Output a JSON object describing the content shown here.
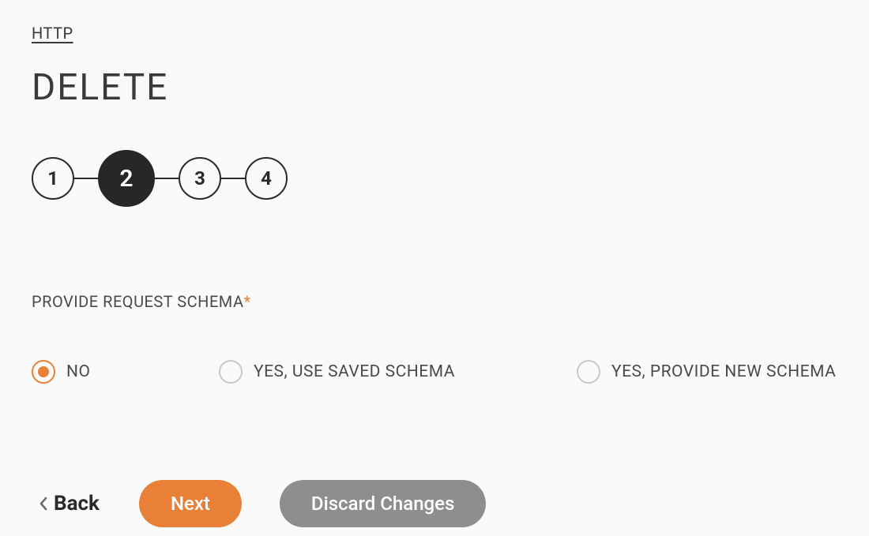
{
  "breadcrumb": {
    "label": "HTTP"
  },
  "title": "DELETE",
  "stepper": {
    "steps": [
      {
        "label": "1",
        "active": false
      },
      {
        "label": "2",
        "active": true
      },
      {
        "label": "3",
        "active": false
      },
      {
        "label": "4",
        "active": false
      }
    ]
  },
  "form": {
    "request_schema_label": "PROVIDE REQUEST SCHEMA",
    "required_mark": "*",
    "options": {
      "no_label": "NO",
      "use_saved_label": "YES, USE SAVED SCHEMA",
      "provide_new_label": "YES, PROVIDE NEW SCHEMA",
      "selected": "no"
    }
  },
  "actions": {
    "back_label": "Back",
    "next_label": "Next",
    "discard_label": "Discard Changes"
  }
}
